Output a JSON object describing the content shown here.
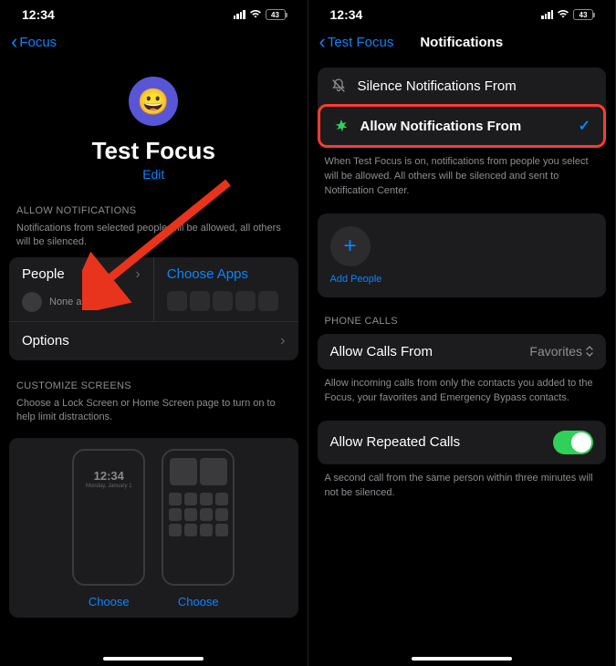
{
  "status": {
    "time": "12:34",
    "battery": "43"
  },
  "left": {
    "back": "Focus",
    "focus_title": "Test Focus",
    "edit": "Edit",
    "allow_header": "ALLOW NOTIFICATIONS",
    "allow_desc": "Notifications from selected people will be allowed, all others will be silenced.",
    "people_label": "People",
    "people_sub": "None allowed",
    "apps_label": "Choose Apps",
    "options_label": "Options",
    "customize_header": "CUSTOMIZE SCREENS",
    "customize_desc": "Choose a Lock Screen or Home Screen page to turn on to help limit distractions.",
    "lock_time": "12:34",
    "lock_date": "Monday, January 1",
    "choose": "Choose"
  },
  "right": {
    "back": "Test Focus",
    "title": "Notifications",
    "silence_label": "Silence Notifications From",
    "allow_label": "Allow Notifications From",
    "allow_desc": "When Test Focus is on, notifications from people you select will be allowed. All others will be silenced and sent to Notification Center.",
    "add_people": "Add People",
    "phone_header": "PHONE CALLS",
    "calls_from_label": "Allow Calls From",
    "calls_from_value": "Favorites",
    "calls_desc": "Allow incoming calls from only the contacts you added to the Focus, your favorites and Emergency Bypass contacts.",
    "repeated_label": "Allow Repeated Calls",
    "repeated_desc": "A second call from the same person within three minutes will not be silenced."
  }
}
